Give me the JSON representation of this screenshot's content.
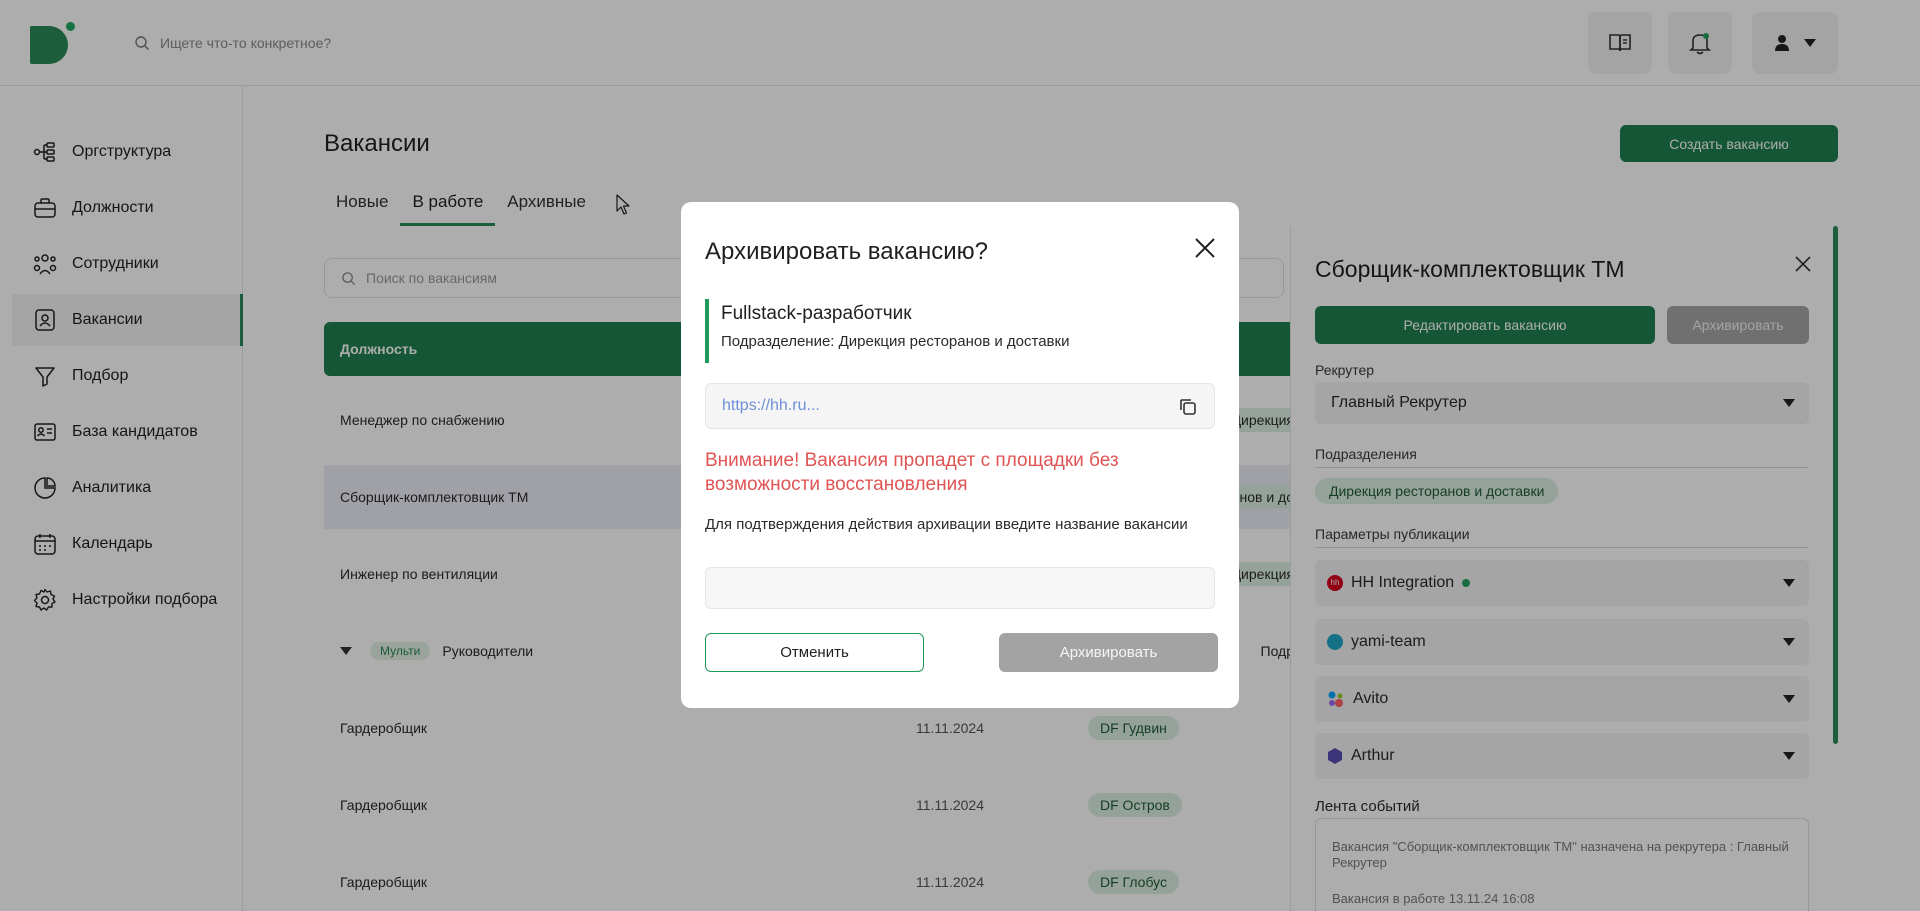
{
  "header": {
    "search_placeholder": "Ищете что-то конкретное?"
  },
  "sidebar": {
    "items": [
      {
        "label": "Оргструктура"
      },
      {
        "label": "Должности"
      },
      {
        "label": "Сотрудники"
      },
      {
        "label": "Вакансии"
      },
      {
        "label": "Подбор"
      },
      {
        "label": "База кандидатов"
      },
      {
        "label": "Аналитика"
      },
      {
        "label": "Календарь"
      },
      {
        "label": "Настройки подбора"
      }
    ],
    "active_index": 3
  },
  "main": {
    "title": "Вакансии",
    "create_button": "Создать вакансию",
    "tabs": [
      {
        "label": "Новые"
      },
      {
        "label": "В работе"
      },
      {
        "label": "Архивные"
      }
    ],
    "active_tab": 1,
    "search_placeholder": "Поиск по вакансиям",
    "table_header": "Должность",
    "rows": [
      {
        "title": "Менеджер по снабжению",
        "cut": "Дирекция"
      },
      {
        "title": "Сборщик-комплектовщик ТМ",
        "cut": "нов и до"
      },
      {
        "title": "Инженер по вентиляции",
        "cut": "Дирекция"
      },
      {
        "group_badge": "Мульти",
        "title": "Руководители",
        "cut": "Подр"
      },
      {
        "title": "Гардеробщик",
        "date": "11.11.2024",
        "chip": "DF Гудвин"
      },
      {
        "title": "Гардеробщик",
        "date": "11.11.2024",
        "chip": "DF Остров"
      },
      {
        "title": "Гардеробщик",
        "date": "11.11.2024",
        "chip": "DF Глобус"
      }
    ]
  },
  "panel": {
    "title": "Сборщик-комплектовщик ТМ",
    "edit_button": "Редактировать вакансию",
    "archive_button": "Архивировать",
    "recruiter_label": "Рекрутер",
    "recruiter_value": "Главный Рекрутер",
    "departments_label": "Подразделения",
    "department_chip": "Дирекция ресторанов и доставки",
    "publication_label": "Параметры публикации",
    "services": [
      {
        "name": "HH Integration",
        "icon_text": "hh",
        "color": "#d6001c"
      },
      {
        "name": "yami-team",
        "color": "#1ea7c9"
      },
      {
        "name": "Avito",
        "color": "#00aaff"
      },
      {
        "name": "Arthur",
        "color": "#5b4fb3"
      }
    ],
    "events_label": "Лента событий",
    "events": [
      "Вакансия \"Сборщик-комплектовщик ТМ\" назначена на рекрутера : Главный Рекрутер",
      "Вакансия в работе 13.11.24 16:08"
    ]
  },
  "modal": {
    "title": "Архивировать вакансию?",
    "vacancy_name": "Fullstack-разработчик",
    "department": "Подразделение: Дирекция ресторанов и доставки",
    "link": "https://hh.ru...",
    "warning": "Внимание! Вакансия пропадет с площадки без возможности восстановления",
    "hint": "Для подтверждения действия архивации введите название вакансии",
    "input_value": "",
    "cancel_button": "Отменить",
    "archive_button": "Архивировать"
  },
  "colors": {
    "brand_green": "#1e7f4e",
    "warning_red": "#e05454",
    "disabled_gray": "#a3a3a3"
  }
}
